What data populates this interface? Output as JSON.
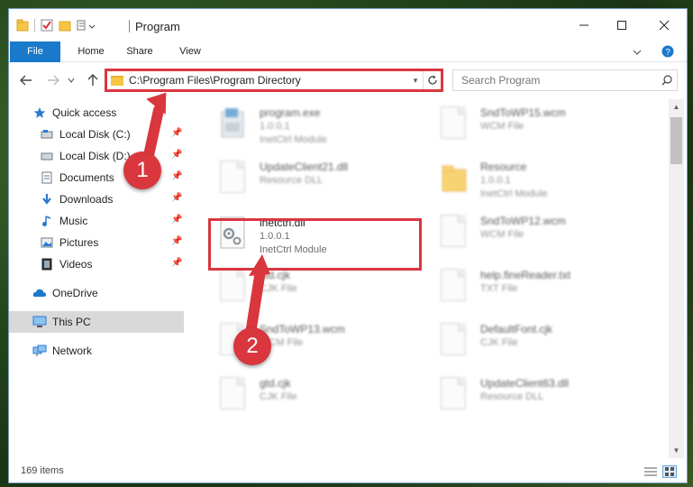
{
  "window": {
    "title": "Program"
  },
  "ribbon": {
    "tabs": {
      "file": "File",
      "home": "Home",
      "share": "Share",
      "view": "View"
    }
  },
  "address": {
    "path": "C:\\Program Files\\Program Directory",
    "search_placeholder": "Search Program"
  },
  "sidebar": {
    "quick_access": "Quick access",
    "local_c": "Local Disk (C:)",
    "local_d": "Local Disk (D:)",
    "documents": "Documents",
    "downloads": "Downloads",
    "music": "Music",
    "pictures": "Pictures",
    "videos": "Videos",
    "onedrive": "OneDrive",
    "thispc": "This PC",
    "network": "Network"
  },
  "files": [
    {
      "name": "program.exe",
      "version": "1.0.0.1",
      "type": "InetCtrl Module"
    },
    {
      "name": "SndToWP15.wcm",
      "version": "WCM File",
      "type": ""
    },
    {
      "name": "UpdateClient21.dll",
      "version": "Resource DLL",
      "type": ""
    },
    {
      "name": "Resource",
      "version": "1.0.0.1",
      "type": "InetCtrl Module"
    },
    {
      "name": "inetctrl.dll",
      "version": "1.0.0.1",
      "type": "InetCtrl Module"
    },
    {
      "name": "SndToWP12.wcm",
      "version": "WCM File",
      "type": ""
    },
    {
      "name": "std.cjk",
      "version": "CJK File",
      "type": ""
    },
    {
      "name": "help.fineReader.txt",
      "version": "TXT File",
      "type": ""
    },
    {
      "name": "SndToWP13.wcm",
      "version": "WCM File",
      "type": ""
    },
    {
      "name": "DefaultFont.cjk",
      "version": "CJK File",
      "type": ""
    },
    {
      "name": "gtd.cjk",
      "version": "CJK File",
      "type": ""
    },
    {
      "name": "UpdateClient63.dll",
      "version": "Resource DLL",
      "type": ""
    }
  ],
  "status": {
    "items": "169 items"
  },
  "annotations": {
    "step1": "1",
    "step2": "2"
  },
  "colors": {
    "accent": "#1979ca",
    "highlight": "#d9363e",
    "folder": "#f6c544"
  }
}
